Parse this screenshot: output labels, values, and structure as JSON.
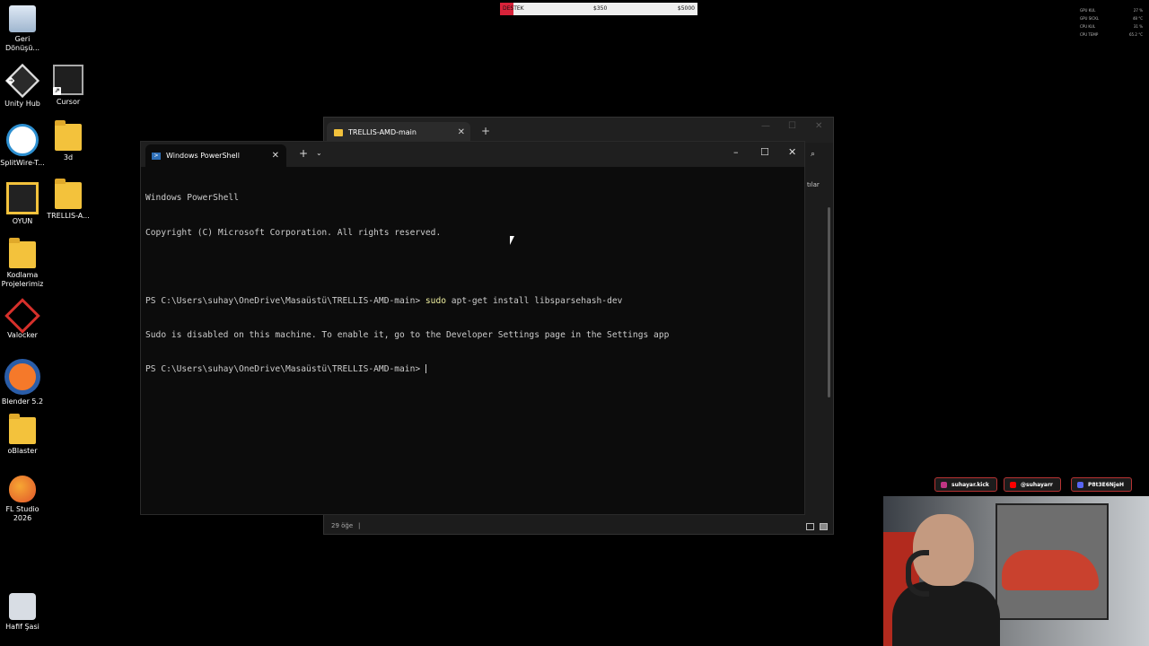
{
  "desktop": {
    "icons": [
      {
        "label": "Geri Dönüşü...",
        "icon": "recycle-bin-icon"
      },
      {
        "label": "Unity Hub",
        "icon": "unity-hub-icon"
      },
      {
        "label": "Cursor",
        "icon": "cursor-app-icon"
      },
      {
        "label": "SplitWire-T...",
        "icon": "splitwire-icon"
      },
      {
        "label": "3d",
        "icon": "folder-icon"
      },
      {
        "label": "OYUN",
        "icon": "oyun-icon"
      },
      {
        "label": "TRELLIS-A...",
        "icon": "folder-icon"
      },
      {
        "label": "Kodlama Projelerimiz",
        "icon": "folder-icon"
      },
      {
        "label": "Valocker",
        "icon": "valocker-icon"
      },
      {
        "label": "Blender 5.2",
        "icon": "blender-icon"
      },
      {
        "label": "oBlaster",
        "icon": "folder-icon"
      },
      {
        "label": "FL Studio 2026",
        "icon": "fl-studio-icon"
      },
      {
        "label": "Hafif Şasi",
        "icon": "hafif-sasi-icon"
      }
    ]
  },
  "donation_bar": {
    "label": "DESTEK",
    "current": "$350",
    "goal": "$5000",
    "progress": 0.07,
    "fill_color": "#d8233a"
  },
  "hw_stats": [
    {
      "label": "GPU KUL",
      "value": "27 %"
    },
    {
      "label": "GPU SICKL",
      "value": "48 °C"
    },
    {
      "label": "CPU KUL",
      "value": "31 %"
    },
    {
      "label": "CPU TEMP",
      "value": "65.2 °C"
    }
  ],
  "explorer": {
    "tab_title": "TRELLIS-AMD-main",
    "column_header": "tılar",
    "status": "29 öğe"
  },
  "powershell": {
    "tab_title": "Windows PowerShell",
    "lines": [
      "Windows PowerShell",
      "Copyright (C) Microsoft Corporation. All rights reserved.",
      "",
      "PS C:\\Users\\suhay\\OneDrive\\Masaüstü\\TRELLIS-AMD-main> ",
      "Sudo is disabled on this machine. To enable it, go to the Developer Settings page in the Settings app",
      "PS C:\\Users\\suhay\\OneDrive\\Masaüstü\\TRELLIS-AMD-main> "
    ],
    "command_keyword": "sudo",
    "command_rest": " apt-get install libsparsehash-dev"
  },
  "social": [
    {
      "label": "suhayar.kick",
      "icon": "instagram-icon",
      "color": "#c13584"
    },
    {
      "label": "@suhayarr",
      "icon": "youtube-icon",
      "color": "#ff0000"
    },
    {
      "label": "P8t3E6NjeH",
      "icon": "discord-icon",
      "color": "#5865f2"
    }
  ]
}
